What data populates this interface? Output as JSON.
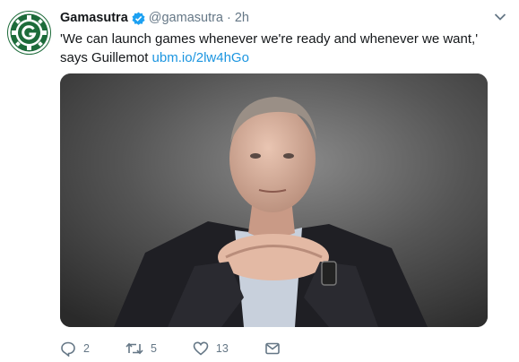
{
  "tweet": {
    "author_name": "Gamasutra",
    "verified_icon": "verified-badge-icon",
    "handle": "@gamasutra",
    "separator": "·",
    "time": "2h",
    "text": "'We can launch games whenever we're ready and whenever we want,' says Guillemot ",
    "link": "ubm.io/2lw4hGo",
    "media_icon": "photo-of-man",
    "actions": {
      "reply_count": "2",
      "retweet_count": "5",
      "like_count": "13"
    }
  },
  "colors": {
    "link": "#1b95e0",
    "secondary": "#657786",
    "brand": "#1d6b3a",
    "verified": "#1da1f2"
  }
}
